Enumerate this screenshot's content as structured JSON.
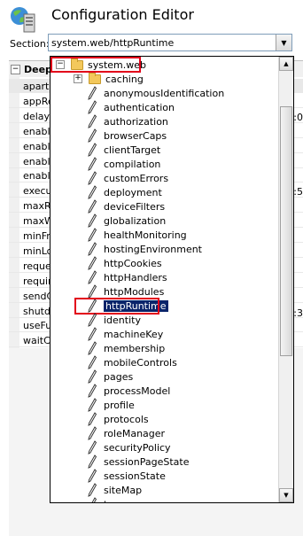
{
  "header": {
    "title": "Configuration Editor",
    "section_label": "Section:",
    "section_value": "system.web/httpRuntime"
  },
  "grid": {
    "group_title": "Deep",
    "rows": [
      "apart",
      "appRe",
      "delayI",
      "enable",
      "enable",
      "enable",
      "enable",
      "execu",
      "maxR",
      "maxW",
      "minFre",
      "minLo",
      "reque",
      "requir",
      "sendC",
      "shutd",
      "useFu",
      "waitC"
    ],
    "right_values": [
      ":0",
      ":5",
      ":3"
    ]
  },
  "tree": {
    "root": "system.web",
    "folders": [
      "caching"
    ],
    "items": [
      "anonymousIdentification",
      "authentication",
      "authorization",
      "browserCaps",
      "clientTarget",
      "compilation",
      "customErrors",
      "deployment",
      "deviceFilters",
      "globalization",
      "healthMonitoring",
      "hostingEnvironment",
      "httpCookies",
      "httpHandlers",
      "httpModules",
      "httpRuntime",
      "identity",
      "machineKey",
      "membership",
      "mobileControls",
      "pages",
      "processModel",
      "profile",
      "protocols",
      "roleManager",
      "securityPolicy",
      "sessionPageState",
      "sessionState",
      "siteMap",
      "trace"
    ],
    "selected": "httpRuntime",
    "scroll_position": 0.24
  },
  "colors": {
    "highlight": "#e2001a",
    "selection": "#0a246a",
    "folder": "#f3c85b"
  },
  "icons": [
    "config-editor-icon",
    "folder-icon",
    "pen-icon",
    "expand-plus-icon",
    "collapse-minus-icon",
    "scroll-up-arrow-icon",
    "scroll-down-arrow-icon",
    "dropdown-arrow-icon"
  ]
}
